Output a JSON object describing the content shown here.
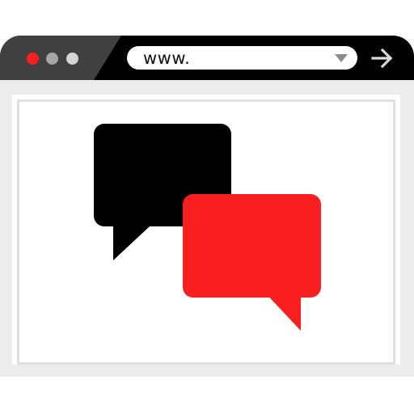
{
  "browser": {
    "address_text": "www.",
    "colors": {
      "close": "#f91e1f",
      "minimize": "#a6a6a6",
      "maximize": "#d4d4d4",
      "titlebar": "#000000",
      "titlebar_left": "#404040",
      "frame": "#ececec"
    },
    "icons": {
      "dropdown": "chevron-down-icon",
      "go": "arrow-right-icon"
    }
  },
  "content": {
    "icon": "chat-bubbles-icon",
    "bubble_colors": [
      "#000000",
      "#f91e1f"
    ]
  }
}
